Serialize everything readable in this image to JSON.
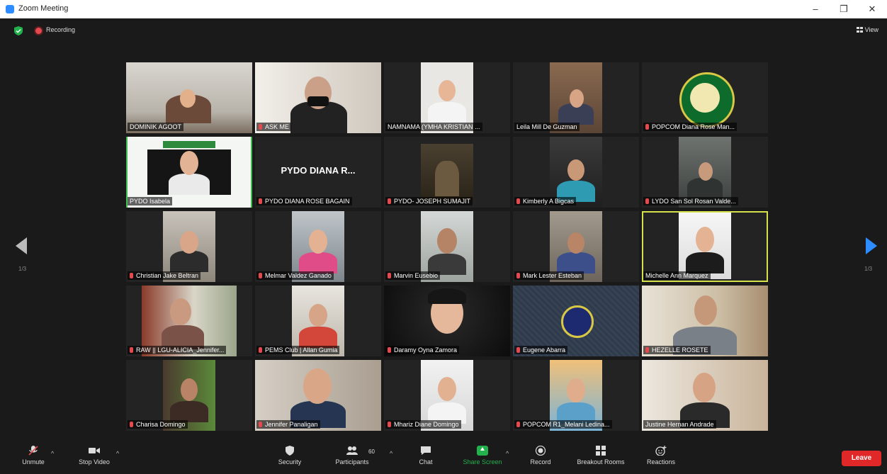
{
  "window": {
    "title": "Zoom Meeting",
    "controls": {
      "minimize": "–",
      "maximize": "❐",
      "close": "✕"
    }
  },
  "topbar": {
    "recording_label": "Recording",
    "view_label": "View"
  },
  "pagination": {
    "left": "1/3",
    "right": "1/3"
  },
  "colors": {
    "accent": "#2D8CFF",
    "active_speaker": "#d6e04a",
    "leave": "#e02828",
    "mic_muted": "#e5484d"
  },
  "participants": [
    {
      "name": "DOMINIK AGOOT",
      "muted": false
    },
    {
      "name": "ASK ME",
      "muted": true
    },
    {
      "name": "NAMNAMA (YMHA KRISTIAN ...",
      "muted": false
    },
    {
      "name": "Leila Mill De Guzman",
      "muted": false
    },
    {
      "name": "POPCOM Diana Rose Man...",
      "muted": true
    },
    {
      "name": "PYDO Isabela",
      "muted": false
    },
    {
      "name": "PYDO DIANA ROSE BAGAIN",
      "muted": true,
      "display": "PYDO DIANA R..."
    },
    {
      "name": "PYDO- JOSEPH SUMAJIT",
      "muted": true
    },
    {
      "name": "Kimberly A Bigcas",
      "muted": true
    },
    {
      "name": "LYDO San Sol Rosan Valde...",
      "muted": true
    },
    {
      "name": "Christian Jake Beltran",
      "muted": true
    },
    {
      "name": "Melmar Valdez Ganado",
      "muted": true
    },
    {
      "name": "Marvin Eusebio",
      "muted": true
    },
    {
      "name": "Mark Lester Esteban",
      "muted": true
    },
    {
      "name": "Michelle Ann Marquez",
      "muted": false
    },
    {
      "name": "RAW || LGU-ALICIA_Jennifer...",
      "muted": true
    },
    {
      "name": "PEMS Club | Allan Gumia",
      "muted": true
    },
    {
      "name": "Daramy Oyna Zamora",
      "muted": true
    },
    {
      "name": "Eugene Abarra",
      "muted": true
    },
    {
      "name": "HEZELLE ROSETE",
      "muted": true
    },
    {
      "name": "Charisa Domingo",
      "muted": true
    },
    {
      "name": "Jennifer Panaligan",
      "muted": true
    },
    {
      "name": "Mhariz Diane Domingo",
      "muted": true
    },
    {
      "name": "POPCOM R1_Melani Ledina...",
      "muted": true
    },
    {
      "name": "Justine Hernan Andrade",
      "muted": false
    }
  ],
  "toolbar": {
    "unmute": "Unmute",
    "stop_video": "Stop Video",
    "security": "Security",
    "participants": "Participants",
    "participants_count": "60",
    "chat": "Chat",
    "share_screen": "Share Screen",
    "record": "Record",
    "breakout_rooms": "Breakout Rooms",
    "reactions": "Reactions",
    "leave": "Leave"
  }
}
